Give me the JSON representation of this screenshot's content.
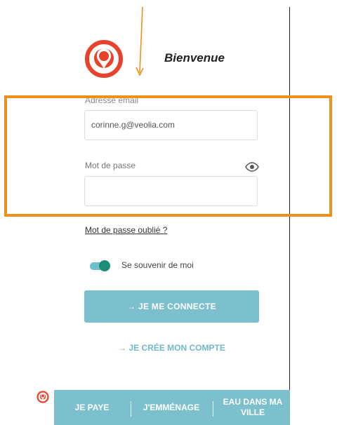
{
  "header": {
    "title": "Bienvenue",
    "logo_icon": "veolia-logo-icon"
  },
  "form": {
    "email_label": "Adresse email",
    "email_value": "corinne.g@veolia.com",
    "password_label": "Mot de passe",
    "password_value": "",
    "show_password_icon": "eye-icon",
    "forgot_link": "Mot de passe oublié ?",
    "remember_label": "Se souvenir de moi",
    "remember_on": true,
    "connect_button": "→  JE ME CONNECTE",
    "create_link": "→  JE CRÉE MON COMPTE"
  },
  "tabbar": {
    "items": [
      {
        "label": "JE PAYE"
      },
      {
        "label": "J'EMMÉNAGE"
      },
      {
        "label": "EAU DANS MA VILLE"
      }
    ]
  },
  "colors": {
    "brand_red": "#e8412c",
    "accent_blue": "#7cc0cd",
    "toggle_green": "#1c8d77",
    "highlight_orange": "#f0901c"
  }
}
